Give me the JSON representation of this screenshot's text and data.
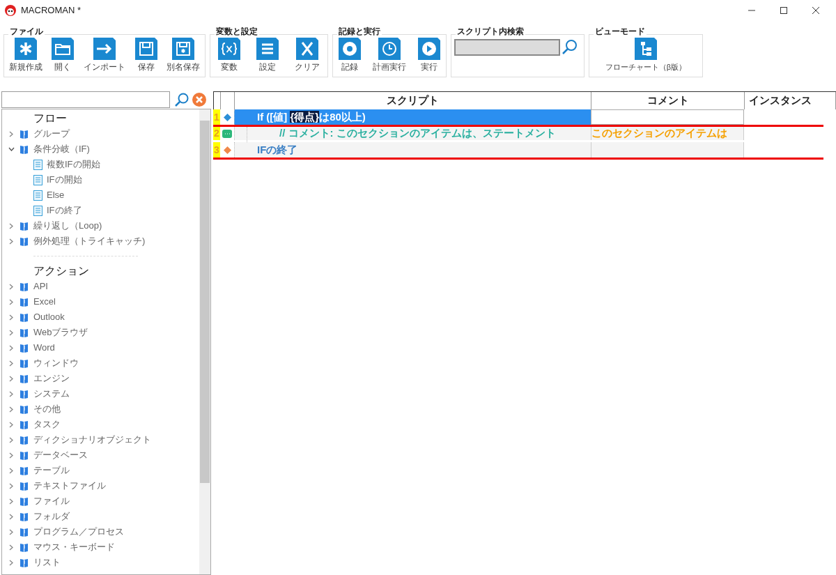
{
  "window": {
    "title": "MACROMAN *"
  },
  "ribbon": {
    "groups": [
      {
        "title": "ファイル",
        "buttons": [
          {
            "label": "新規作成"
          },
          {
            "label": "開く"
          },
          {
            "label": "インポート"
          },
          {
            "label": "保存"
          },
          {
            "label": "別名保存"
          }
        ]
      },
      {
        "title": "変数と設定",
        "buttons": [
          {
            "label": "変数"
          },
          {
            "label": "設定"
          },
          {
            "label": "クリア"
          }
        ]
      },
      {
        "title": "記録と実行",
        "buttons": [
          {
            "label": "記録"
          },
          {
            "label": "計画実行"
          },
          {
            "label": "実行"
          }
        ]
      }
    ],
    "search": {
      "title": "スクリプト内検索"
    },
    "view_mode": {
      "title": "ビューモード",
      "button": "フローチャート（β版）"
    }
  },
  "tree": [
    {
      "heading": "フロー",
      "items": [
        {
          "label": "グループ",
          "expanded": false
        },
        {
          "label": "条件分岐（IF)",
          "expanded": true,
          "children": [
            {
              "label": "複数IFの開始"
            },
            {
              "label": "IFの開始"
            },
            {
              "label": "Else"
            },
            {
              "label": "IFの終了"
            }
          ]
        },
        {
          "label": "繰り返し（Loop)",
          "expanded": false
        },
        {
          "label": "例外処理（トライキャッチ)",
          "expanded": false
        }
      ]
    },
    {
      "heading": "アクション",
      "items": [
        {
          "label": "API",
          "expanded": false
        },
        {
          "label": "Excel",
          "expanded": false
        },
        {
          "label": "Outlook",
          "expanded": false
        },
        {
          "label": "Webブラウザ",
          "expanded": false
        },
        {
          "label": "Word",
          "expanded": false
        },
        {
          "label": "ウィンドウ",
          "expanded": false
        },
        {
          "label": "エンジン",
          "expanded": false
        },
        {
          "label": "システム",
          "expanded": false
        },
        {
          "label": "その他",
          "expanded": false
        },
        {
          "label": "タスク",
          "expanded": false
        },
        {
          "label": "ディクショナリオブジェクト",
          "expanded": false
        },
        {
          "label": "データベース",
          "expanded": false
        },
        {
          "label": "テーブル",
          "expanded": false
        },
        {
          "label": "テキストファイル",
          "expanded": false
        },
        {
          "label": "ファイル",
          "expanded": false
        },
        {
          "label": "フォルダ",
          "expanded": false
        },
        {
          "label": "プログラム／プロセス",
          "expanded": false
        },
        {
          "label": "マウス・キーボード",
          "expanded": false
        },
        {
          "label": "リスト",
          "expanded": false
        }
      ]
    }
  ],
  "script": {
    "columns": [
      "スクリプト",
      "コメント",
      "インスタンス"
    ],
    "rows": [
      {
        "number": "1",
        "kind": "if",
        "selected": true,
        "underlined": true,
        "parts": [
          {
            "text": "If ([値] ",
            "highlight": false
          },
          {
            "text": "{得点}",
            "highlight": true
          },
          {
            "text": "は80以上)",
            "highlight": false
          }
        ],
        "children": [
          {
            "number": "2",
            "kind": "comment",
            "selected": false,
            "underlined": false,
            "parts": [
              {
                "text": "// コメント: このセクションのアイテムは、ステートメント",
                "highlight": false
              }
            ],
            "comment": "このセクションのアイテムは"
          }
        ]
      },
      {
        "number": "3",
        "kind": "end",
        "selected": false,
        "underlined": true,
        "parts": [
          {
            "text": "IFの終了",
            "highlight": false
          }
        ]
      }
    ]
  }
}
